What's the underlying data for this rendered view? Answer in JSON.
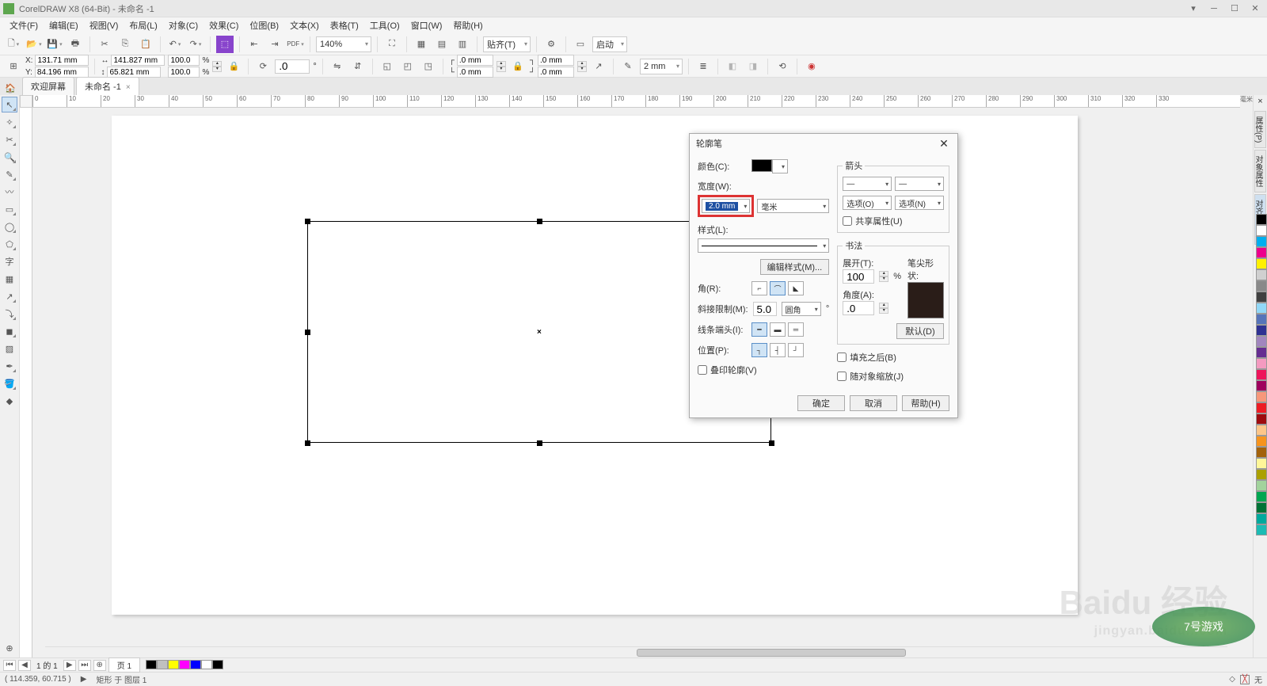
{
  "app": {
    "title": "CorelDRAW X8 (64-Bit) - 未命名 -1"
  },
  "menus": [
    "文件(F)",
    "编辑(E)",
    "视图(V)",
    "布局(L)",
    "对象(C)",
    "效果(C)",
    "位图(B)",
    "文本(X)",
    "表格(T)",
    "工具(O)",
    "窗口(W)",
    "帮助(H)"
  ],
  "toolbar1": {
    "zoom": "140%",
    "align": "贴齐(T)",
    "launch": "启动"
  },
  "props": {
    "x": "131.71 mm",
    "y": "84.196 mm",
    "w": "141.827 mm",
    "h": "65.821 mm",
    "scale_x": "100.0",
    "scale_y": "100.0",
    "angle": ".0",
    "corner": ".0 mm",
    "corner2": ".0 mm",
    "corner3": ".0 mm",
    "corner4": ".0 mm",
    "outline": "2 mm"
  },
  "tabs": {
    "welcome": "欢迎屏幕",
    "doc": "未命名 -1"
  },
  "ruler_unit": "毫米",
  "page_nav": {
    "label": "1 的 1",
    "page_tab": "页 1"
  },
  "status": {
    "coords": "( 114.359, 60.715 )",
    "arrow": "▶",
    "layer": "矩形 于 图层 1",
    "fill_none": "无"
  },
  "dialog": {
    "title": "轮廓笔",
    "color_label": "颜色(C):",
    "width_label": "宽度(W):",
    "width_value": "2.0 mm",
    "unit": "毫米",
    "style_label": "样式(L):",
    "edit_style": "编辑样式(M)...",
    "corner_label": "角(R):",
    "miter_label": "斜接限制(M):",
    "miter_value": "5.0",
    "miter_unit": "圆角",
    "miter_deg": "°",
    "cap_label": "线条端头(I):",
    "pos_label": "位置(P):",
    "overprint": "叠印轮廓(V)",
    "arrows_label": "箭头",
    "options1": "选项(O)",
    "options2": "选项(N)",
    "share": "共享属性(U)",
    "calligraphy": "书法",
    "stretch_label": "展开(T):",
    "stretch_value": "100",
    "stretch_pct": "%",
    "nib_label": "笔尖形状:",
    "angle_label": "角度(A):",
    "angle_value": ".0",
    "default_btn": "默认(D)",
    "behind": "填充之后(B)",
    "scale": "随对象缩放(J)",
    "ok": "确定",
    "cancel": "取消",
    "help": "帮助(H)"
  },
  "right_panels": [
    "属性(P)",
    "对象属性",
    "对齐与分布"
  ],
  "palette": [
    "#000000",
    "#ffffff",
    "#00aeef",
    "#ed008c",
    "#fff100",
    "#d0d0d0",
    "#898989",
    "#404040",
    "#92d8f7",
    "#5674b9",
    "#2e3192",
    "#a186be",
    "#662d91",
    "#f49ac0",
    "#ee145b",
    "#9e005d",
    "#f7977a",
    "#ed1c24",
    "#9e0b0f",
    "#fdc689",
    "#f7941d",
    "#a3620a",
    "#fff799",
    "#aba000",
    "#a2d39c",
    "#00a651",
    "#007236",
    "#00a99d",
    "#1cbbb4"
  ],
  "mini_palette": [
    "#000000",
    "#c0c0c0",
    "#ffff00",
    "#ff00ff",
    "#0000ff",
    "#ffffff",
    "#000000"
  ],
  "watermark": {
    "main": "Baidu 经验",
    "sub": "jingyan.baidu...com"
  },
  "badge": "7号游戏"
}
